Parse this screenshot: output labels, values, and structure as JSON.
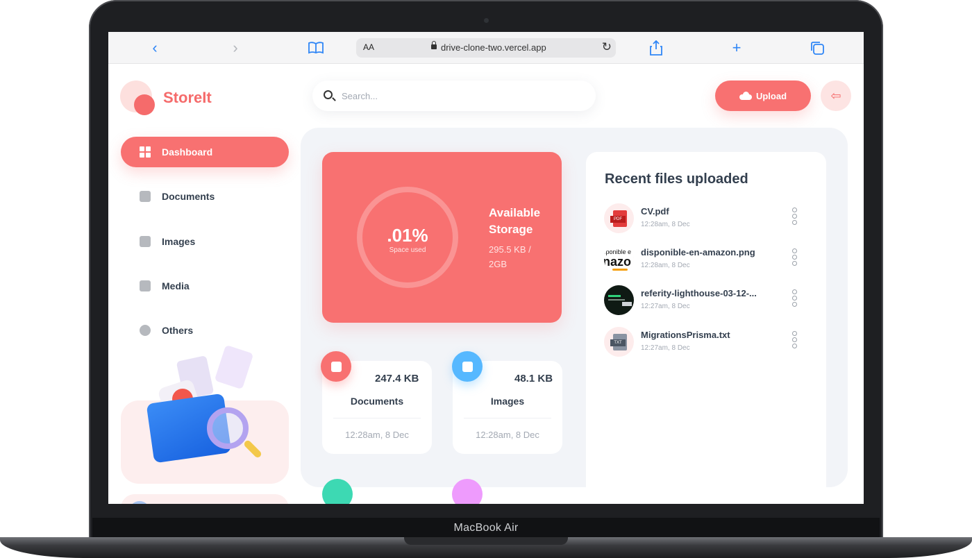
{
  "device": {
    "label": "MacBook Air"
  },
  "browser": {
    "text_size_label": "AA",
    "url": "drive-clone-two.vercel.app",
    "icons": [
      "chevron-left-icon",
      "chevron-right-icon",
      "book-icon",
      "reload-icon",
      "share-icon",
      "plus-icon",
      "tabs-icon"
    ]
  },
  "app": {
    "name": "StoreIt",
    "accent": "#f87171"
  },
  "sidebar": {
    "items": [
      {
        "label": "Dashboard",
        "icon": "dashboard-icon",
        "active": true
      },
      {
        "label": "Documents",
        "icon": "document-icon",
        "active": false
      },
      {
        "label": "Images",
        "icon": "image-icon",
        "active": false
      },
      {
        "label": "Media",
        "icon": "video-icon",
        "active": false
      },
      {
        "label": "Others",
        "icon": "pie-chart-icon",
        "active": false
      }
    ]
  },
  "header": {
    "search_placeholder": "Search...",
    "upload_label": "Upload"
  },
  "storage": {
    "used_percent": ".01%",
    "used_caption": "Space used",
    "title": "Available Storage",
    "value": "295.5 KB / 2GB"
  },
  "categories": [
    {
      "name": "Documents",
      "size": "247.4 KB",
      "date": "12:28am, 8 Dec",
      "color": "#f87171"
    },
    {
      "name": "Images",
      "size": "48.1 KB",
      "date": "12:28am, 8 Dec",
      "color": "#56b8ff"
    }
  ],
  "recent": {
    "title": "Recent files uploaded",
    "files": [
      {
        "name": "CV.pdf",
        "date": "12:28am, 8 Dec",
        "thumb_tag": "PDF"
      },
      {
        "name": "disponible-en-amazon.png",
        "date": "12:28am, 8 Dec",
        "thumb_text_1": "sponible e",
        "thumb_text_2": "nazo"
      },
      {
        "name": "referity-lighthouse-03-12-...",
        "date": "12:27am, 8 Dec"
      },
      {
        "name": "MigrationsPrisma.txt",
        "date": "12:27am, 8 Dec",
        "thumb_tag": "TXT"
      }
    ]
  }
}
